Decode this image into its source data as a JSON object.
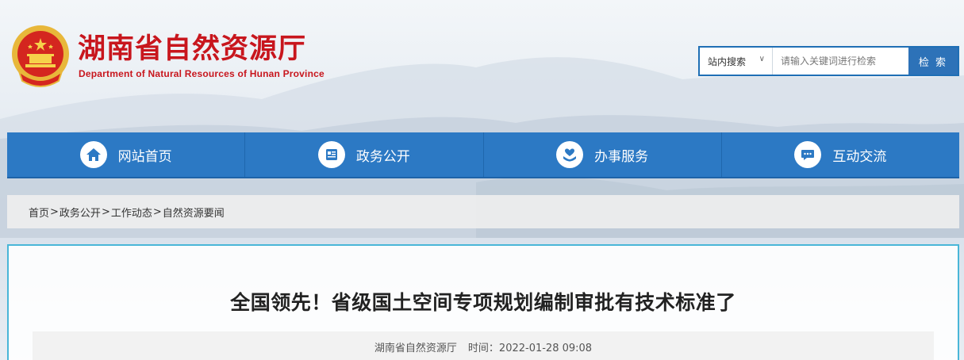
{
  "header": {
    "title": "湖南省自然资源厅",
    "subtitle": "Department of Natural Resources of Hunan Province"
  },
  "search": {
    "scope": "站内搜索",
    "placeholder": "请输入关键词进行检索",
    "button": "检 索"
  },
  "nav": {
    "items": [
      {
        "label": "网站首页",
        "icon": "home-icon"
      },
      {
        "label": "政务公开",
        "icon": "document-icon"
      },
      {
        "label": "办事服务",
        "icon": "heart-hand-icon"
      },
      {
        "label": "互动交流",
        "icon": "chat-icon"
      }
    ]
  },
  "breadcrumb": [
    "首页",
    "政务公开",
    "工作动态",
    "自然资源要闻"
  ],
  "article": {
    "title": "全国领先！省级国土空间专项规划编制审批有技术标准了",
    "source": "湖南省自然资源厅",
    "time": "时间：2022-01-28 09:08"
  },
  "colors": {
    "brand_red": "#c8161d",
    "nav_blue": "#2c79c4",
    "search_blue": "#2d72b8",
    "panel_border": "#49b6d8"
  }
}
